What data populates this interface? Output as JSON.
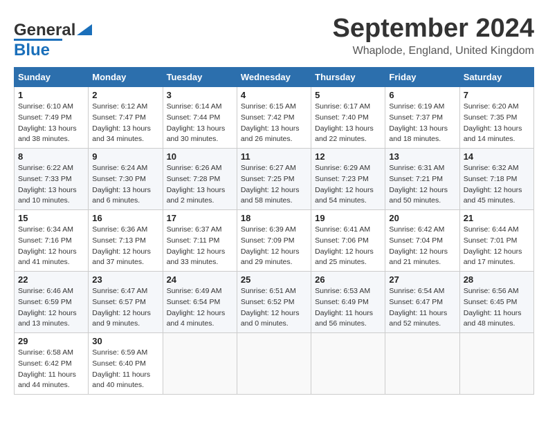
{
  "logo": {
    "text_general": "General",
    "text_blue": "Blue"
  },
  "header": {
    "month_title": "September 2024",
    "subtitle": "Whaplode, England, United Kingdom"
  },
  "columns": [
    "Sunday",
    "Monday",
    "Tuesday",
    "Wednesday",
    "Thursday",
    "Friday",
    "Saturday"
  ],
  "weeks": [
    [
      {
        "day": "1",
        "info": "Sunrise: 6:10 AM\nSunset: 7:49 PM\nDaylight: 13 hours\nand 38 minutes."
      },
      {
        "day": "2",
        "info": "Sunrise: 6:12 AM\nSunset: 7:47 PM\nDaylight: 13 hours\nand 34 minutes."
      },
      {
        "day": "3",
        "info": "Sunrise: 6:14 AM\nSunset: 7:44 PM\nDaylight: 13 hours\nand 30 minutes."
      },
      {
        "day": "4",
        "info": "Sunrise: 6:15 AM\nSunset: 7:42 PM\nDaylight: 13 hours\nand 26 minutes."
      },
      {
        "day": "5",
        "info": "Sunrise: 6:17 AM\nSunset: 7:40 PM\nDaylight: 13 hours\nand 22 minutes."
      },
      {
        "day": "6",
        "info": "Sunrise: 6:19 AM\nSunset: 7:37 PM\nDaylight: 13 hours\nand 18 minutes."
      },
      {
        "day": "7",
        "info": "Sunrise: 6:20 AM\nSunset: 7:35 PM\nDaylight: 13 hours\nand 14 minutes."
      }
    ],
    [
      {
        "day": "8",
        "info": "Sunrise: 6:22 AM\nSunset: 7:33 PM\nDaylight: 13 hours\nand 10 minutes."
      },
      {
        "day": "9",
        "info": "Sunrise: 6:24 AM\nSunset: 7:30 PM\nDaylight: 13 hours\nand 6 minutes."
      },
      {
        "day": "10",
        "info": "Sunrise: 6:26 AM\nSunset: 7:28 PM\nDaylight: 13 hours\nand 2 minutes."
      },
      {
        "day": "11",
        "info": "Sunrise: 6:27 AM\nSunset: 7:25 PM\nDaylight: 12 hours\nand 58 minutes."
      },
      {
        "day": "12",
        "info": "Sunrise: 6:29 AM\nSunset: 7:23 PM\nDaylight: 12 hours\nand 54 minutes."
      },
      {
        "day": "13",
        "info": "Sunrise: 6:31 AM\nSunset: 7:21 PM\nDaylight: 12 hours\nand 50 minutes."
      },
      {
        "day": "14",
        "info": "Sunrise: 6:32 AM\nSunset: 7:18 PM\nDaylight: 12 hours\nand 45 minutes."
      }
    ],
    [
      {
        "day": "15",
        "info": "Sunrise: 6:34 AM\nSunset: 7:16 PM\nDaylight: 12 hours\nand 41 minutes."
      },
      {
        "day": "16",
        "info": "Sunrise: 6:36 AM\nSunset: 7:13 PM\nDaylight: 12 hours\nand 37 minutes."
      },
      {
        "day": "17",
        "info": "Sunrise: 6:37 AM\nSunset: 7:11 PM\nDaylight: 12 hours\nand 33 minutes."
      },
      {
        "day": "18",
        "info": "Sunrise: 6:39 AM\nSunset: 7:09 PM\nDaylight: 12 hours\nand 29 minutes."
      },
      {
        "day": "19",
        "info": "Sunrise: 6:41 AM\nSunset: 7:06 PM\nDaylight: 12 hours\nand 25 minutes."
      },
      {
        "day": "20",
        "info": "Sunrise: 6:42 AM\nSunset: 7:04 PM\nDaylight: 12 hours\nand 21 minutes."
      },
      {
        "day": "21",
        "info": "Sunrise: 6:44 AM\nSunset: 7:01 PM\nDaylight: 12 hours\nand 17 minutes."
      }
    ],
    [
      {
        "day": "22",
        "info": "Sunrise: 6:46 AM\nSunset: 6:59 PM\nDaylight: 12 hours\nand 13 minutes."
      },
      {
        "day": "23",
        "info": "Sunrise: 6:47 AM\nSunset: 6:57 PM\nDaylight: 12 hours\nand 9 minutes."
      },
      {
        "day": "24",
        "info": "Sunrise: 6:49 AM\nSunset: 6:54 PM\nDaylight: 12 hours\nand 4 minutes."
      },
      {
        "day": "25",
        "info": "Sunrise: 6:51 AM\nSunset: 6:52 PM\nDaylight: 12 hours\nand 0 minutes."
      },
      {
        "day": "26",
        "info": "Sunrise: 6:53 AM\nSunset: 6:49 PM\nDaylight: 11 hours\nand 56 minutes."
      },
      {
        "day": "27",
        "info": "Sunrise: 6:54 AM\nSunset: 6:47 PM\nDaylight: 11 hours\nand 52 minutes."
      },
      {
        "day": "28",
        "info": "Sunrise: 6:56 AM\nSunset: 6:45 PM\nDaylight: 11 hours\nand 48 minutes."
      }
    ],
    [
      {
        "day": "29",
        "info": "Sunrise: 6:58 AM\nSunset: 6:42 PM\nDaylight: 11 hours\nand 44 minutes."
      },
      {
        "day": "30",
        "info": "Sunrise: 6:59 AM\nSunset: 6:40 PM\nDaylight: 11 hours\nand 40 minutes."
      },
      {
        "day": "",
        "info": ""
      },
      {
        "day": "",
        "info": ""
      },
      {
        "day": "",
        "info": ""
      },
      {
        "day": "",
        "info": ""
      },
      {
        "day": "",
        "info": ""
      }
    ]
  ]
}
